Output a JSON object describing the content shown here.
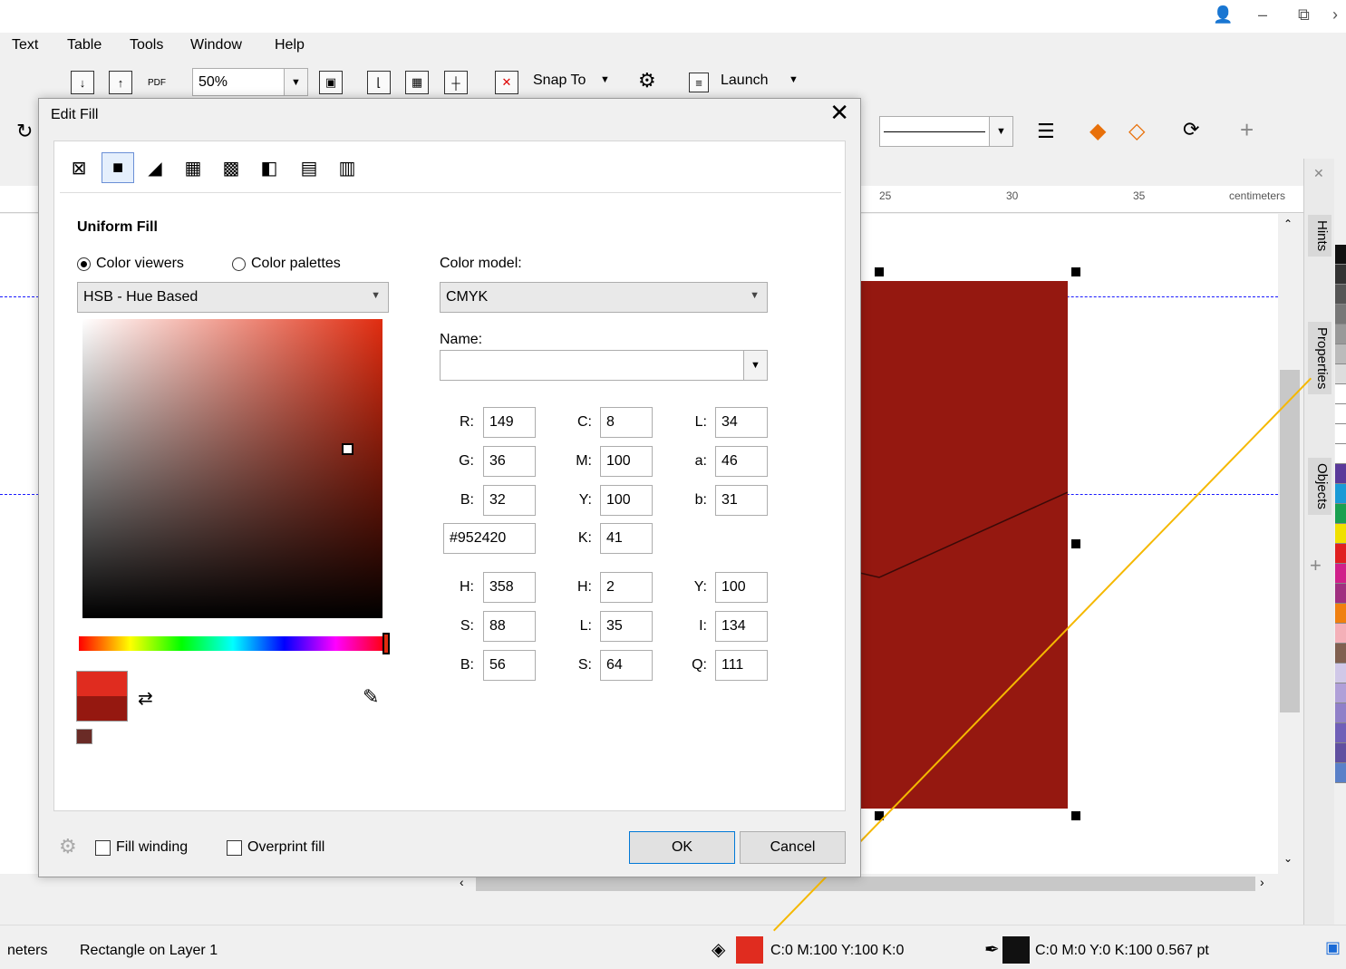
{
  "menu": [
    "Text",
    "Table",
    "Tools",
    "Window",
    "Help"
  ],
  "toolbar": {
    "zoom": "50%",
    "snap_to": "Snap To",
    "launch": "Launch"
  },
  "ruler": {
    "ticks": [
      "25",
      "30",
      "35"
    ],
    "unit": "centimeters"
  },
  "docker_tabs": [
    "Hints",
    "Properties",
    "Objects"
  ],
  "dialog": {
    "title": "Edit Fill",
    "section_title": "Uniform Fill",
    "radio_viewers": "Color viewers",
    "radio_palettes": "Color palettes",
    "viewer_select": "HSB - Hue Based",
    "color_model_label": "Color model:",
    "color_model": "CMYK",
    "name_label": "Name:",
    "name_value": "",
    "rgb": {
      "r_label": "R:",
      "r": "149",
      "g_label": "G:",
      "g": "36",
      "b_label": "B:",
      "b": "32"
    },
    "hex": "#952420",
    "cmyk": {
      "c_label": "C:",
      "c": "8",
      "m_label": "M:",
      "m": "100",
      "y_label": "Y:",
      "y": "100",
      "k_label": "K:",
      "k": "41"
    },
    "lab": {
      "l_label": "L:",
      "l": "34",
      "a_label": "a:",
      "a": "46",
      "b_label": "b:",
      "b": "31"
    },
    "hsb": {
      "h_label": "H:",
      "h": "358",
      "s_label": "S:",
      "s": "88",
      "b_label": "B:",
      "b": "56"
    },
    "hls": {
      "h_label": "H:",
      "h": "2",
      "l_label": "L:",
      "l": "35",
      "s_label": "S:",
      "s": "64"
    },
    "yiq": {
      "y_label": "Y:",
      "y": "100",
      "i_label": "I:",
      "i": "134",
      "q_label": "Q:",
      "q": "111"
    },
    "fill_winding": "Fill winding",
    "overprint_fill": "Overprint fill",
    "ok": "OK",
    "cancel": "Cancel"
  },
  "status": {
    "units": "neters",
    "object": "Rectangle on Layer 1",
    "fill_info": "C:0 M:100 Y:100 K:0",
    "outline_info": "C:0 M:0 Y:0 K:100  0.567 pt"
  },
  "colors": {
    "object_fill": "#951810",
    "old_color": "#e02c1f",
    "status_fill": "#e02c1f",
    "accent": "#0078d7"
  }
}
